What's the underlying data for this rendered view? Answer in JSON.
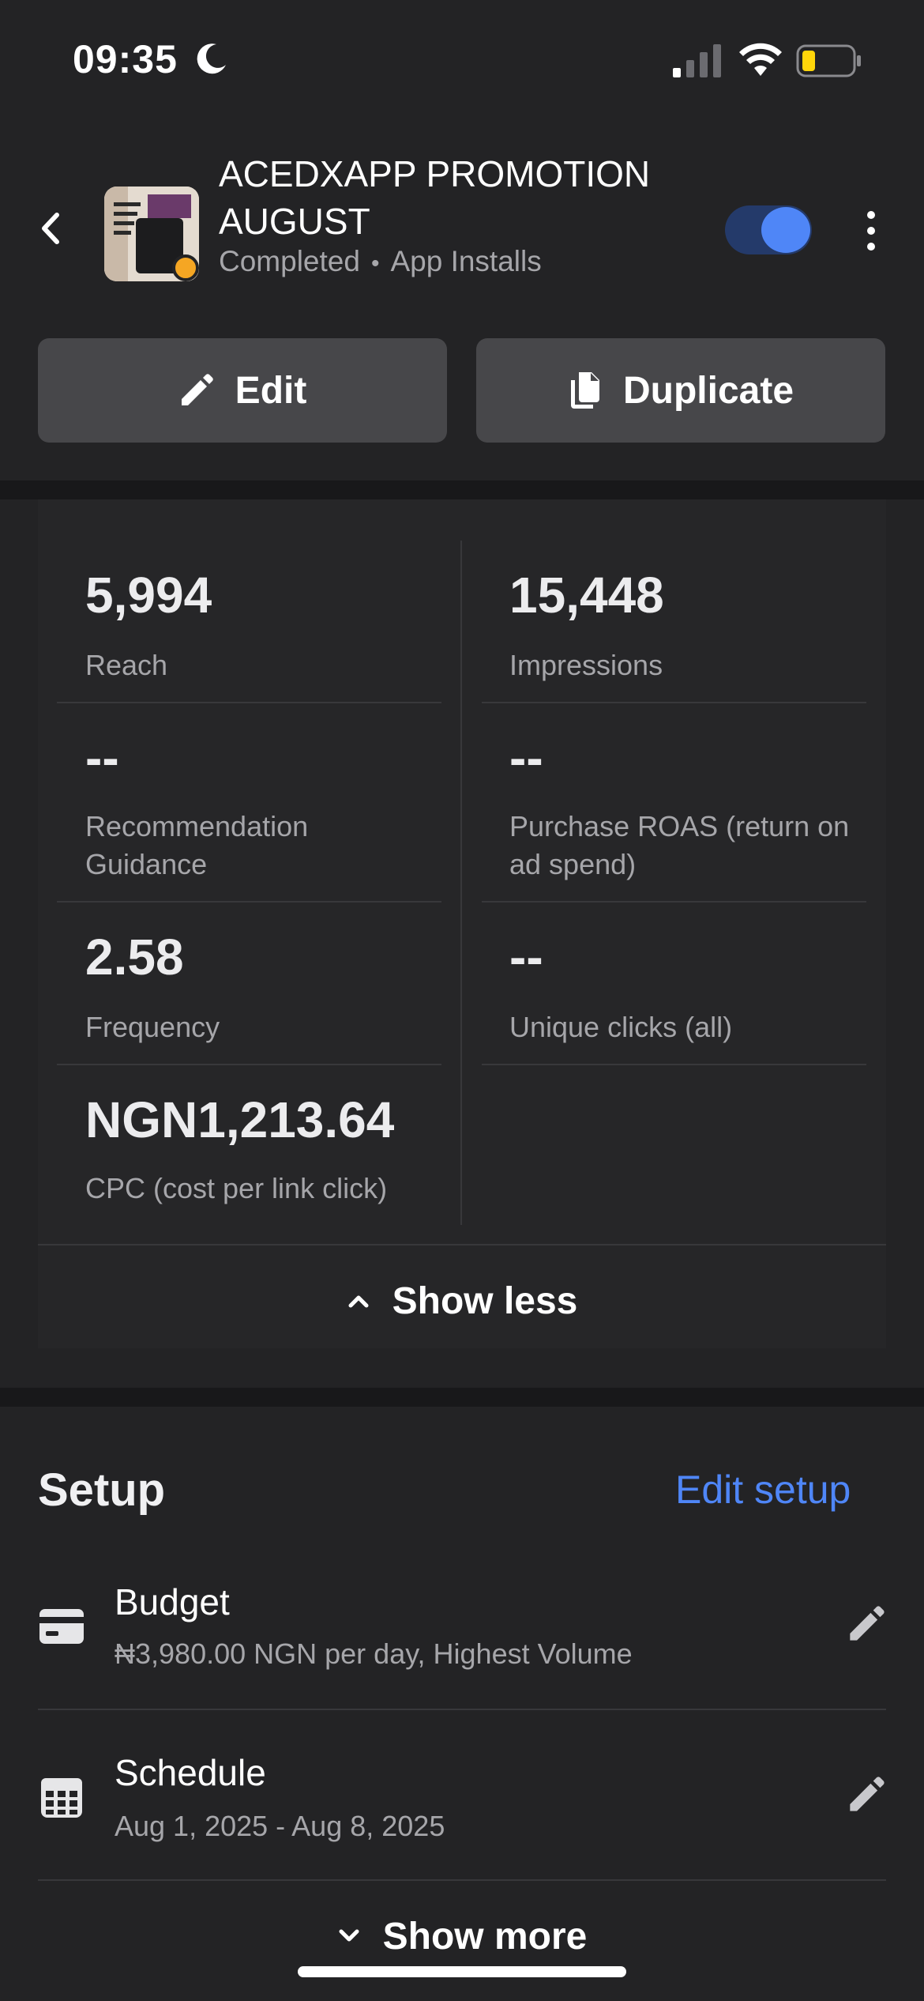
{
  "status_bar": {
    "time": "09:35"
  },
  "campaign": {
    "title": "ACEDXAPP PROMOTION AUGUST",
    "status": "Completed",
    "separator": "•",
    "objective": "App Installs",
    "active": true
  },
  "actions": {
    "edit_label": "Edit",
    "duplicate_label": "Duplicate"
  },
  "metrics": [
    {
      "value": "5,994",
      "label": "Reach"
    },
    {
      "value": "15,448",
      "label": "Impressions"
    },
    {
      "value": "--",
      "label": "Recommendation Guidance"
    },
    {
      "value": "--",
      "label": "Purchase ROAS (return on ad spend)"
    },
    {
      "value": "2.58",
      "label": "Frequency"
    },
    {
      "value": "--",
      "label": "Unique clicks (all)"
    },
    {
      "value": "NGN1,213.64",
      "label": "CPC (cost per link click)"
    }
  ],
  "metrics_toggle": {
    "label": "Show less"
  },
  "setup": {
    "title": "Setup",
    "edit_label": "Edit setup",
    "rows": [
      {
        "title": "Budget",
        "subtitle": "₦3,980.00 NGN per day, Highest Volume",
        "icon": "card-icon"
      },
      {
        "title": "Schedule",
        "subtitle": "Aug 1, 2025 - Aug 8, 2025",
        "icon": "calendar-icon"
      }
    ],
    "show_more_label": "Show more"
  },
  "colors": {
    "accent": "#4f86f7",
    "background": "#232325",
    "status_dot": "#f5a623"
  }
}
